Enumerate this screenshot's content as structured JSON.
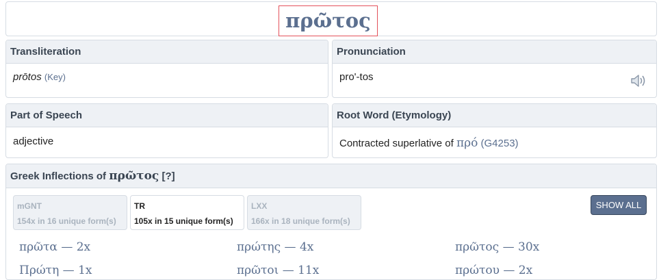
{
  "header": {
    "lemma": "πρῶτος"
  },
  "transliteration": {
    "label": "Transliteration",
    "value": "prōtos",
    "key_link": "(Key)"
  },
  "pronunciation": {
    "label": "Pronunciation",
    "value": "pro'-tos",
    "icon": "speaker-icon"
  },
  "part_of_speech": {
    "label": "Part of Speech",
    "value": "adjective"
  },
  "root_word": {
    "label": "Root Word (Etymology)",
    "text": "Contracted superlative of",
    "greek": "πρό",
    "strongs": "(G4253)"
  },
  "inflections": {
    "title_prefix": "Greek Inflections of",
    "lemma": "πρῶτος",
    "help": "[?]",
    "tabs": [
      {
        "name": "mGNT",
        "detail": "154x in 16 unique form(s)",
        "active": false
      },
      {
        "name": "TR",
        "detail": "105x in 15 unique form(s)",
        "active": true
      },
      {
        "name": "LXX",
        "detail": "166x in 18 unique form(s)",
        "active": false
      }
    ],
    "show_all_label": "SHOW ALL",
    "forms": [
      {
        "text": "πρῶτα — 2x"
      },
      {
        "text": "πρώτης — 4x"
      },
      {
        "text": "πρῶτος — 30x"
      },
      {
        "text": "Πρώτη — 1x"
      },
      {
        "text": "πρῶτοι — 11x"
      },
      {
        "text": "πρώτου — 2x"
      }
    ]
  }
}
